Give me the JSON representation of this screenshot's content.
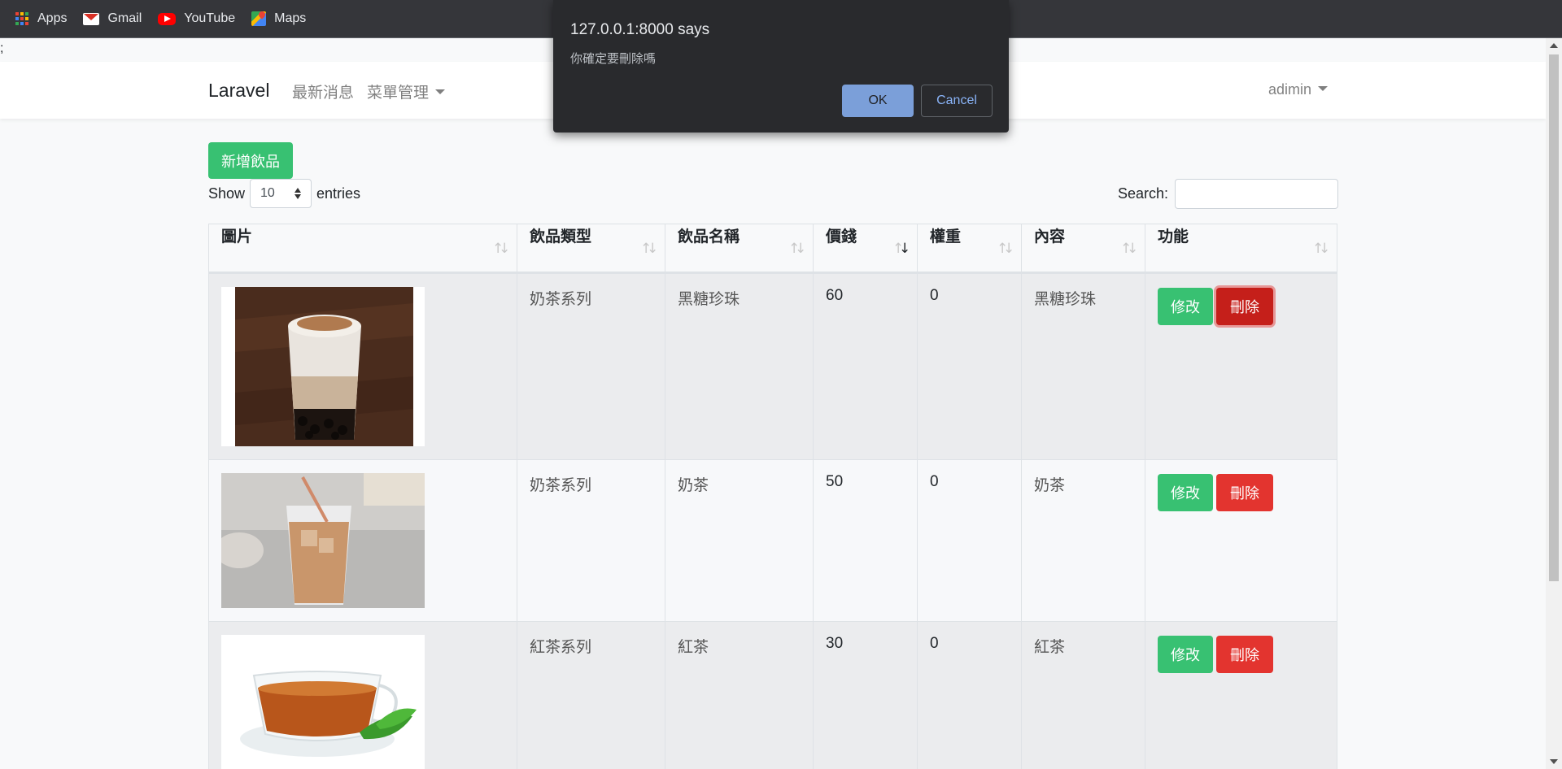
{
  "bookmarks": [
    {
      "label": "Apps",
      "icon": "apps-icon"
    },
    {
      "label": "Gmail",
      "icon": "gmail-icon"
    },
    {
      "label": "YouTube",
      "icon": "youtube-icon"
    },
    {
      "label": "Maps",
      "icon": "maps-icon"
    }
  ],
  "page_artifact": ";",
  "navbar": {
    "brand": "Laravel",
    "news": "最新消息",
    "menu_mgmt": "菜單管理",
    "user": "adimin"
  },
  "toolbar": {
    "add_label": "新增飲品",
    "show_label": "Show",
    "page_length": "10",
    "entries_label": "entries",
    "search_label": "Search:"
  },
  "table": {
    "headers": [
      "圖片",
      "飲品類型",
      "飲品名稱",
      "價錢",
      "權重",
      "內容",
      "功能"
    ],
    "sorted_column": "價錢",
    "rows": [
      {
        "type": "奶茶系列",
        "name": "黑糖珍珠",
        "price": "60",
        "weight": "0",
        "content": "黑糖珍珠",
        "image": "brown-sugar-bubble-tea-photo"
      },
      {
        "type": "奶茶系列",
        "name": "奶茶",
        "price": "50",
        "weight": "0",
        "content": "奶茶",
        "image": "milk-tea-photo"
      },
      {
        "type": "紅茶系列",
        "name": "紅茶",
        "price": "30",
        "weight": "0",
        "content": "紅茶",
        "image": "black-tea-cup-photo"
      }
    ],
    "edit_label": "修改",
    "delete_label": "刪除"
  },
  "dialog": {
    "title": "127.0.0.1:8000 says",
    "message": "你確定要刪除嗎",
    "ok": "OK",
    "cancel": "Cancel"
  },
  "colors": {
    "success": "#38c172",
    "danger": "#e3342f",
    "dialog_bg": "#292a2d",
    "dialog_accent": "#8ab4f8"
  }
}
